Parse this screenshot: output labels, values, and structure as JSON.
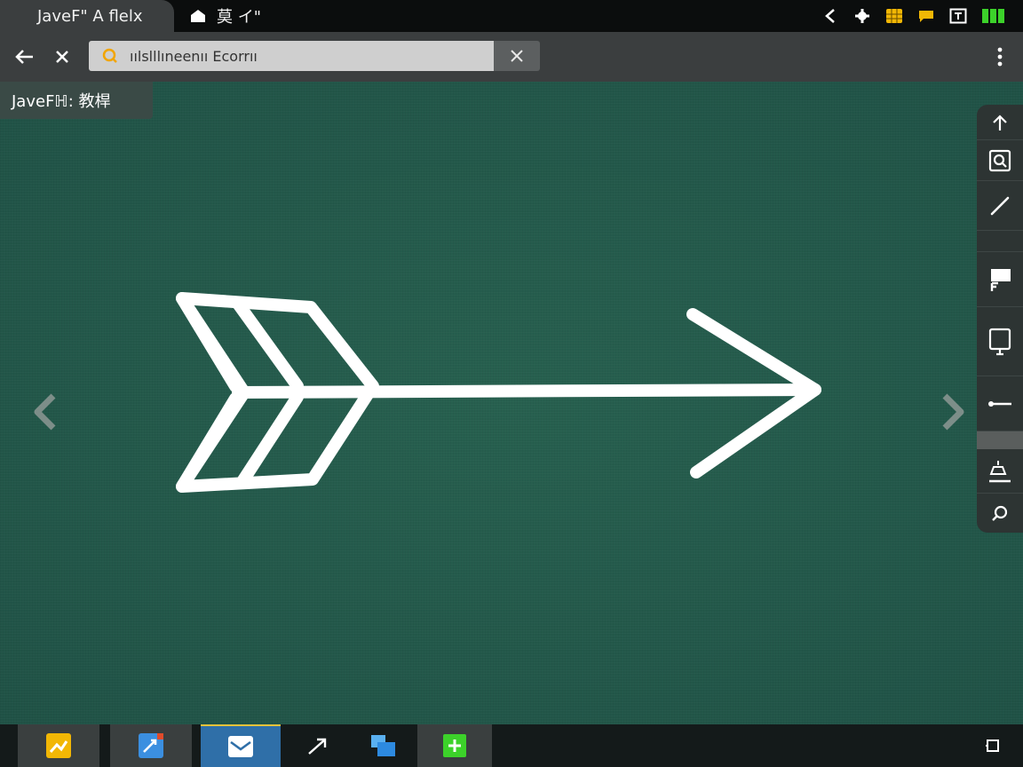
{
  "tabs": {
    "active_label": "JaveF\" A flelx",
    "second_label": "莫 イ\""
  },
  "address_bar": {
    "url_text": "ıılslllıneenıı Ecorrıı"
  },
  "canvas": {
    "title_chip": "JaveFℍ: 教桿"
  },
  "icons": {
    "back": "back-arrow-icon",
    "close": "close-icon",
    "search": "search-icon",
    "clear": "clear-icon",
    "menu": "kebab-menu-icon",
    "home": "home-icon"
  },
  "colors": {
    "canvas_bg": "#23574a",
    "chalk": "#ffffff",
    "accent_yellow": "#f2b705",
    "battery_green": "#3cd22a",
    "active_task": "#2f6fa8"
  }
}
